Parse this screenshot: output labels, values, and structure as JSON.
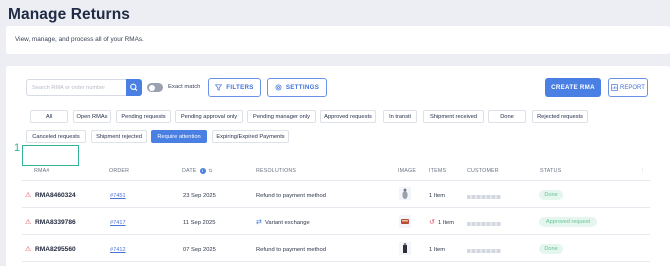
{
  "page": {
    "title": "Manage Returns",
    "description": "View, manage, and process all of your RMAs."
  },
  "toolbar": {
    "search_placeholder": "Search RMA or order number",
    "exact_match_label": "Exact match",
    "filters_label": "FILTERS",
    "settings_label": "SETTINGS",
    "create_label": "CREATE RMA",
    "report_label": "REPORT"
  },
  "status_chips": [
    {
      "label": "All",
      "active": false
    },
    {
      "label": "Open RMAs",
      "active": false
    },
    {
      "label": "Pending requests",
      "active": false
    },
    {
      "label": "Pending approval only",
      "active": false
    },
    {
      "label": "Pending manager only",
      "active": false
    },
    {
      "label": "Approved requests",
      "active": false
    },
    {
      "label": "In transit",
      "active": false
    },
    {
      "label": "Shipment received",
      "active": false
    },
    {
      "label": "Done",
      "active": false
    },
    {
      "label": "Rejected requests",
      "active": false
    },
    {
      "label": "Canceled requests",
      "active": false
    },
    {
      "label": "Shipment rejected",
      "active": false
    },
    {
      "label": "Require attention",
      "active": true
    },
    {
      "label": "Expiring/Expired Payments",
      "active": false
    }
  ],
  "table": {
    "columns": {
      "rma": "RMA#",
      "order": "ORDER",
      "date": "DATE",
      "resolutions": "RESOLUTIONS",
      "image": "IMAGE",
      "items": "ITEMS",
      "customer": "CUSTOMER",
      "status": "STATUS"
    },
    "rows": [
      {
        "rma": "RMA8460324",
        "order": "#7451",
        "date": "23 Sep 2025",
        "resolution": "Refund to payment method",
        "resolution_icon": "",
        "items": "1 Item",
        "items_icon": "",
        "status": "Done"
      },
      {
        "rma": "RMA8339786",
        "order": "#7417",
        "date": "11 Sep 2025",
        "resolution": "Variant exchange",
        "resolution_icon": "exchange-icon",
        "items": "1 Item",
        "items_icon": "return-icon",
        "status": "Approved request"
      },
      {
        "rma": "RMA8295560",
        "order": "#7412",
        "date": "07 Sep 2025",
        "resolution": "Refund to payment method",
        "resolution_icon": "",
        "items": "1 Item",
        "items_icon": "",
        "status": "Done"
      }
    ]
  },
  "annotation": {
    "label": "1",
    "color": "#33b395"
  },
  "colors": {
    "accent": "#4a7fe3",
    "warning": "#e3495b",
    "success_bg": "#e4f6ee",
    "success_text": "#67c29a"
  }
}
